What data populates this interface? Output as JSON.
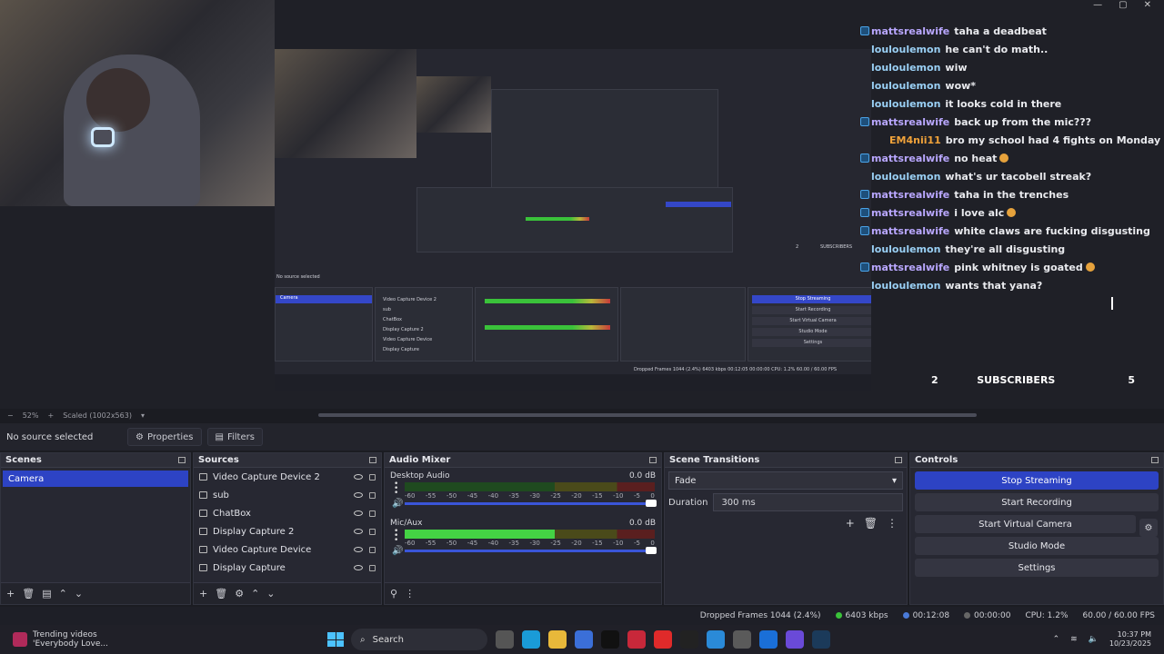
{
  "window_controls": [
    "—",
    "▢",
    "✕"
  ],
  "chat": [
    {
      "user": "mattsrealwife",
      "msg": "taha a deadbeat",
      "color": "#b9a7ff",
      "badge": true,
      "emoji": false
    },
    {
      "user": "louloulemon",
      "msg": "he can't do math..",
      "color": "#9ad0f5",
      "badge": false,
      "emoji": false
    },
    {
      "user": "louloulemon",
      "msg": "wiw",
      "color": "#9ad0f5",
      "badge": false,
      "emoji": false
    },
    {
      "user": "louloulemon",
      "msg": "wow*",
      "color": "#9ad0f5",
      "badge": false,
      "emoji": false
    },
    {
      "user": "louloulemon",
      "msg": "it looks cold in there",
      "color": "#9ad0f5",
      "badge": false,
      "emoji": false
    },
    {
      "user": "mattsrealwife",
      "msg": "back up from the mic???",
      "color": "#b9a7ff",
      "badge": true,
      "emoji": false
    },
    {
      "user": "EM4nii11",
      "msg": "bro my school had 4 fights on Monday",
      "color": "#f0a23a",
      "badge": false,
      "emoji": true
    },
    {
      "user": "mattsrealwife",
      "msg": "no heat",
      "color": "#b9a7ff",
      "badge": true,
      "emoji": true
    },
    {
      "user": "louloulemon",
      "msg": "what's ur tacobell streak?",
      "color": "#9ad0f5",
      "badge": false,
      "emoji": false
    },
    {
      "user": "mattsrealwife",
      "msg": "taha in the trenches",
      "color": "#b9a7ff",
      "badge": true,
      "emoji": false
    },
    {
      "user": "mattsrealwife",
      "msg": "i love alc",
      "color": "#b9a7ff",
      "badge": true,
      "emoji": true
    },
    {
      "user": "mattsrealwife",
      "msg": "white claws are fucking disgusting",
      "color": "#b9a7ff",
      "badge": true,
      "emoji": false
    },
    {
      "user": "louloulemon",
      "msg": "they're all disgusting",
      "color": "#9ad0f5",
      "badge": false,
      "emoji": false
    },
    {
      "user": "mattsrealwife",
      "msg": "pink whitney is goated",
      "color": "#b9a7ff",
      "badge": true,
      "emoji": true
    },
    {
      "user": "louloulemon",
      "msg": "wants that yana?",
      "color": "#9ad0f5",
      "badge": false,
      "emoji": false
    }
  ],
  "subscribers": {
    "left": "2",
    "label": "SUBSCRIBERS",
    "right": "5"
  },
  "zoom": {
    "percent": "52%",
    "scaled": "Scaled (1002x563)"
  },
  "source_bar": {
    "selected": "No source selected",
    "properties": "Properties",
    "filters": "Filters"
  },
  "scenes": {
    "title": "Scenes",
    "items": [
      "Camera"
    ]
  },
  "sources": {
    "title": "Sources",
    "items": [
      "Video Capture Device 2",
      "sub",
      "ChatBox",
      "Display Capture 2",
      "Video Capture Device",
      "Display Capture"
    ]
  },
  "mixer": {
    "title": "Audio Mixer",
    "channels": [
      {
        "name": "Desktop Audio",
        "db": "0.0 dB",
        "level": 0
      },
      {
        "name": "Mic/Aux",
        "db": "0.0 dB",
        "level": 0.6
      }
    ],
    "scale": [
      "-60",
      "-55",
      "-50",
      "-45",
      "-40",
      "-35",
      "-30",
      "-25",
      "-20",
      "-15",
      "-10",
      "-5",
      "0"
    ]
  },
  "transitions": {
    "title": "Scene Transitions",
    "selected": "Fade",
    "duration_label": "Duration",
    "duration": "300 ms"
  },
  "controls": {
    "title": "Controls",
    "buttons": [
      "Stop Streaming",
      "Start Recording",
      "Start Virtual Camera",
      "Studio Mode",
      "Settings"
    ]
  },
  "status": {
    "dropped": "Dropped Frames 1044 (2.4%)",
    "kbps": "6403 kbps",
    "stream_time": "00:12:08",
    "rec_time": "00:00:00",
    "cpu": "CPU: 1.2%",
    "fps": "60.00 / 60.00 FPS"
  },
  "taskbar": {
    "trend_title": "Trending videos",
    "trend_sub": "'Everybody Love...",
    "search": "Search",
    "time": "10:37 PM",
    "date": "10/23/2025"
  },
  "nested": {
    "scene": "Camera",
    "sources": [
      "Video Capture Device 2",
      "sub",
      "ChatBox",
      "Display Capture 2",
      "Video Capture Device",
      "Display Capture"
    ],
    "buttons": [
      "Stop Streaming",
      "Start Recording",
      "Start Virtual Camera",
      "Studio Mode",
      "Settings"
    ],
    "sub_left": "2",
    "sub_label": "SUBSCRIBERS",
    "no_source": "No source selected",
    "status": "Dropped Frames 1044 (2.4%)   6403 kbps   00:12:05   00:00:00   CPU: 1.2%   60.00 / 60.00 FPS"
  }
}
